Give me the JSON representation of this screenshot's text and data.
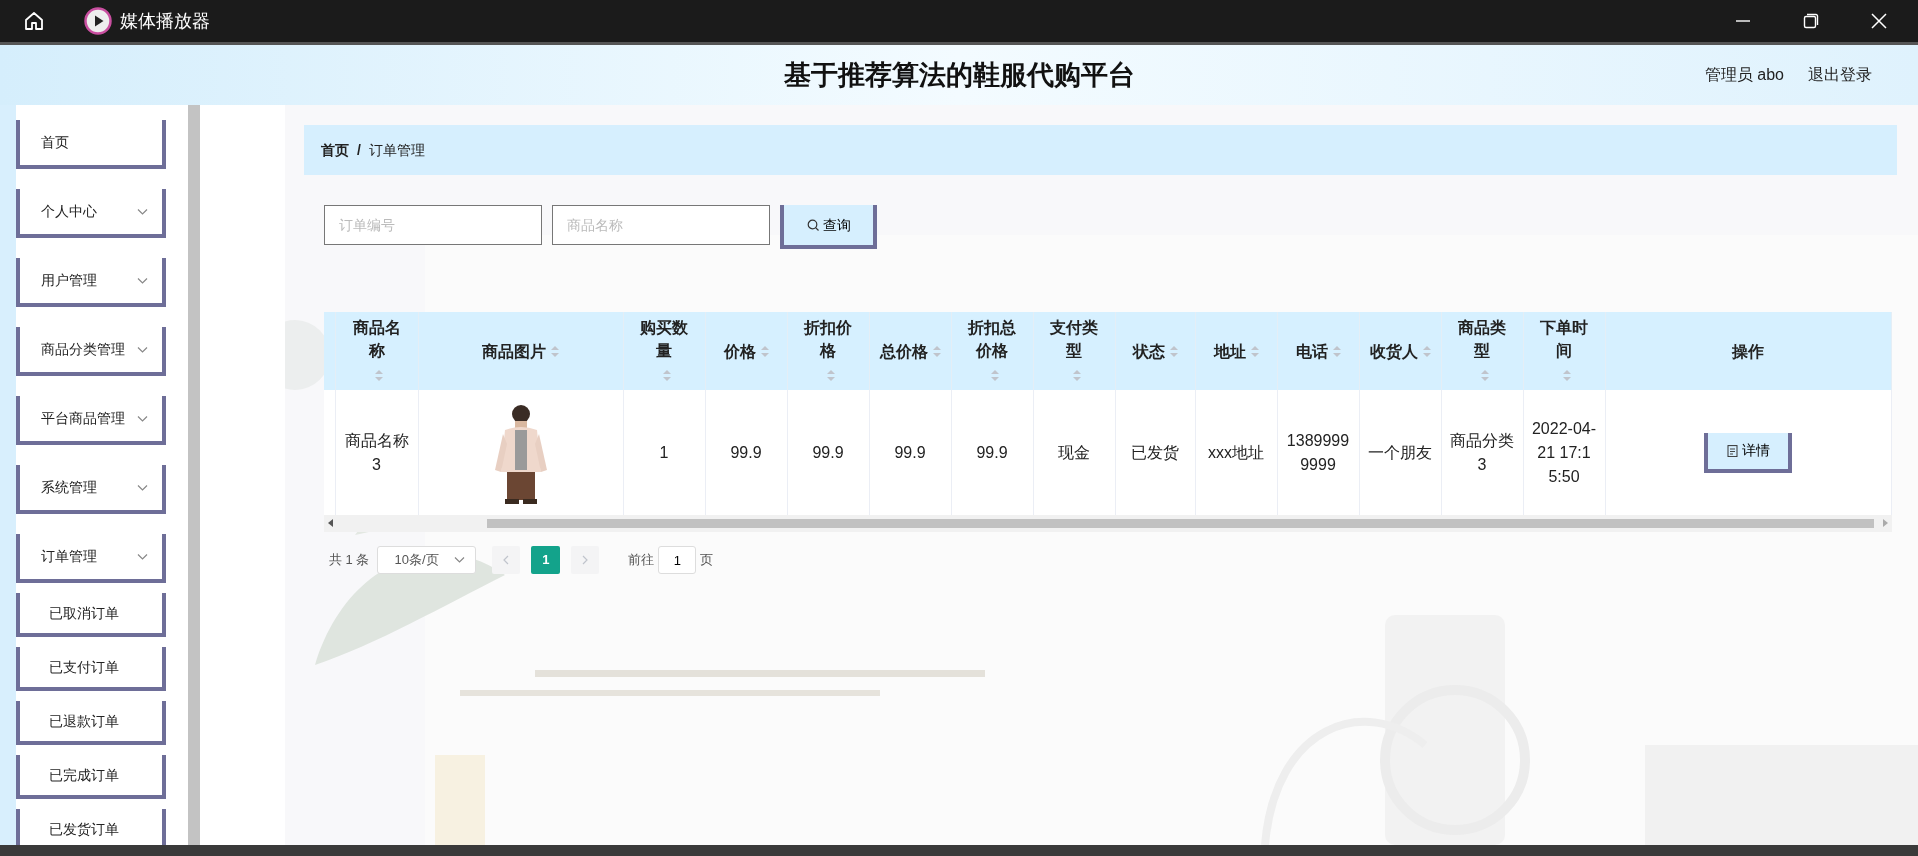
{
  "window": {
    "title": "媒体播放器"
  },
  "header": {
    "title": "基于推荐算法的鞋服代购平台",
    "user": "管理员 abo",
    "logout": "退出登录"
  },
  "sidebar": {
    "items": [
      {
        "label": "首页",
        "kind": "link"
      },
      {
        "label": "个人中心",
        "kind": "submenu"
      },
      {
        "label": "用户管理",
        "kind": "submenu"
      },
      {
        "label": "商品分类管理",
        "kind": "submenu"
      },
      {
        "label": "平台商品管理",
        "kind": "submenu"
      },
      {
        "label": "系统管理",
        "kind": "submenu"
      },
      {
        "label": "订单管理",
        "kind": "submenu",
        "children": [
          {
            "label": "已取消订单"
          },
          {
            "label": "已支付订单"
          },
          {
            "label": "已退款订单"
          },
          {
            "label": "已完成订单"
          },
          {
            "label": "已发货订单"
          }
        ]
      }
    ]
  },
  "breadcrumb": {
    "items": [
      "首页",
      "订单管理"
    ],
    "separator": "/"
  },
  "search": {
    "fields": [
      {
        "placeholder": "订单编号"
      },
      {
        "placeholder": "商品名称"
      }
    ],
    "button": "查询"
  },
  "table": {
    "columns": [
      {
        "label": "商品名称",
        "sortable": true
      },
      {
        "label": "商品图片",
        "sortable": true
      },
      {
        "label": "购买数量",
        "sortable": true
      },
      {
        "label": "价格",
        "sortable": true
      },
      {
        "label": "折扣价格",
        "sortable": true
      },
      {
        "label": "总价格",
        "sortable": true
      },
      {
        "label": "折扣总价格",
        "sortable": true
      },
      {
        "label": "支付类型",
        "sortable": true
      },
      {
        "label": "状态",
        "sortable": true
      },
      {
        "label": "地址",
        "sortable": true
      },
      {
        "label": "电话",
        "sortable": true
      },
      {
        "label": "收货人",
        "sortable": true
      },
      {
        "label": "商品类型",
        "sortable": true
      },
      {
        "label": "下单时间",
        "sortable": true
      },
      {
        "label": "操作",
        "sortable": false
      }
    ],
    "rows": [
      {
        "cells": [
          {
            "kind": "text",
            "text": "商品名称3"
          },
          {
            "kind": "picture"
          },
          {
            "kind": "text",
            "text": "1"
          },
          {
            "kind": "text",
            "text": "99.9"
          },
          {
            "kind": "text",
            "text": "99.9"
          },
          {
            "kind": "text",
            "text": "99.9"
          },
          {
            "kind": "text",
            "text": "99.9"
          },
          {
            "kind": "text",
            "text": "现金"
          },
          {
            "kind": "text",
            "text": "已发货"
          },
          {
            "kind": "text",
            "text": "xxx地址"
          },
          {
            "kind": "text",
            "text": "13899999999"
          },
          {
            "kind": "text",
            "text": "一个朋友"
          },
          {
            "kind": "text",
            "text": "商品分类3"
          },
          {
            "kind": "text",
            "text": "2022-04-21 17:15:50"
          },
          {
            "kind": "action",
            "label": "详情"
          }
        ]
      }
    ]
  },
  "pagination": {
    "total": "共 1 条",
    "page_size": "10条/页",
    "pages": [
      {
        "label": "1",
        "selected": true
      }
    ],
    "goto_label": "前往",
    "goto_value": "1",
    "goto_suffix": "页"
  }
}
